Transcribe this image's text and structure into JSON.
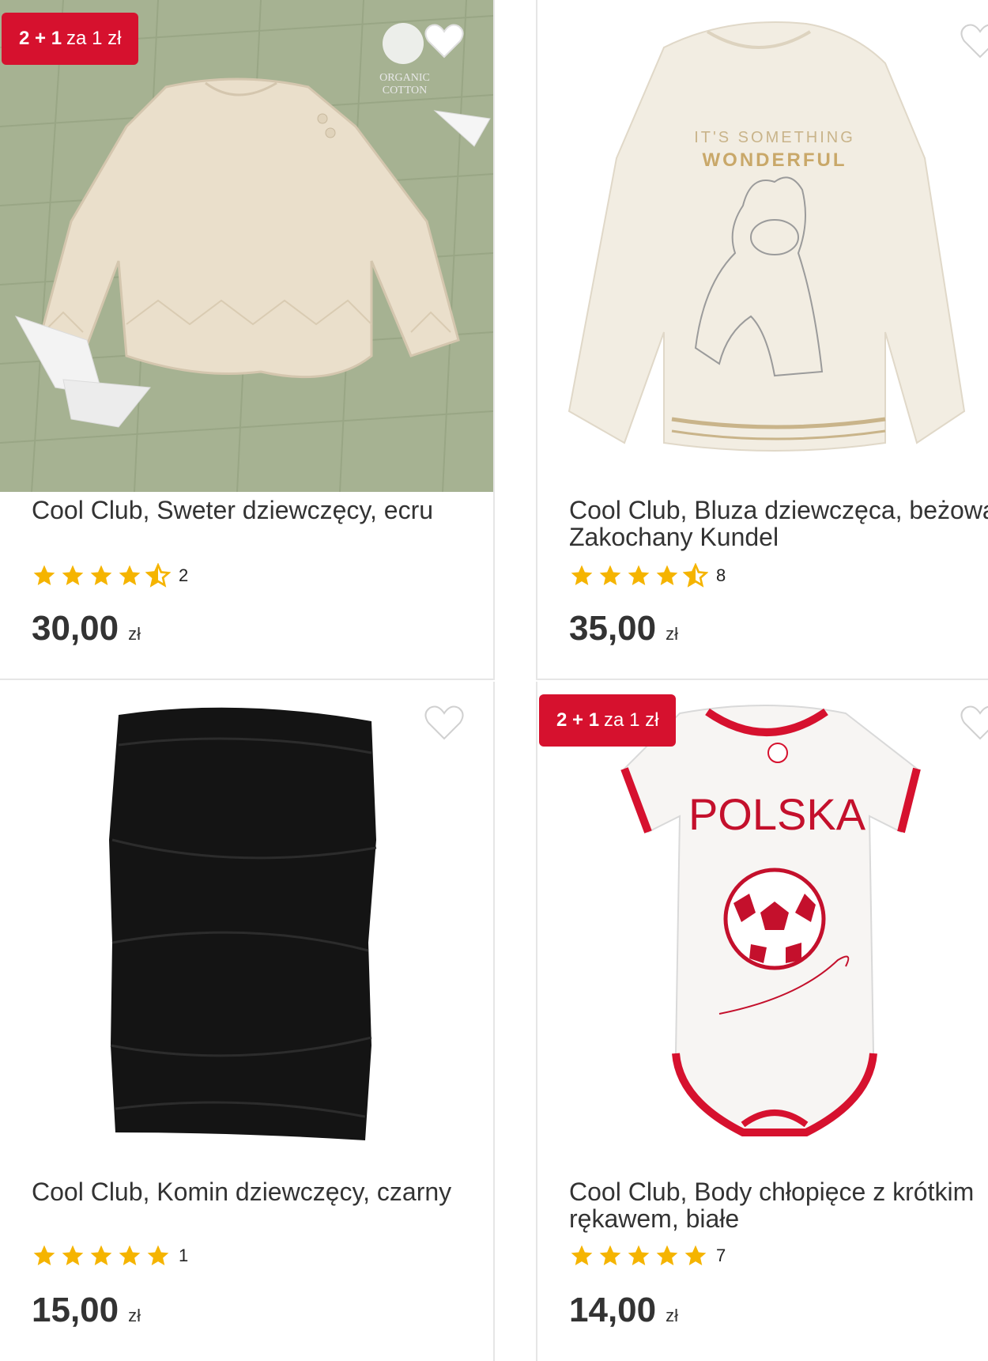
{
  "colors": {
    "badge": "#d6112e",
    "star": "#f5b400",
    "text": "#333333"
  },
  "products": [
    {
      "badge_bold": "2 + 1",
      "badge_text": "za 1 zł",
      "logo_text": "ORGANIC COTTON",
      "title": "Cool Club, Sweter dziewczęcy, ecru",
      "rating": 4.5,
      "rating_count": "2",
      "price": "30,00",
      "currency": "zł"
    },
    {
      "print_text": "IT'S SOMETHING WONDERFUL",
      "title": "Cool Club, Bluza dziewczęca, beżowa, Zakochany Kundel",
      "rating": 4.5,
      "rating_count": "8",
      "price": "35,00",
      "currency": "zł"
    },
    {
      "title": "Cool Club, Komin dziewczęcy, czarny",
      "rating": 5,
      "rating_count": "1",
      "price": "15,00",
      "currency": "zł"
    },
    {
      "badge_bold": "2 + 1",
      "badge_text": "za 1 zł",
      "print_text": "POLSKA",
      "title": "Cool Club, Body chłopięce z krótkim rękawem, białe",
      "rating": 5,
      "rating_count": "7",
      "price": "14,00",
      "currency": "zł"
    }
  ]
}
